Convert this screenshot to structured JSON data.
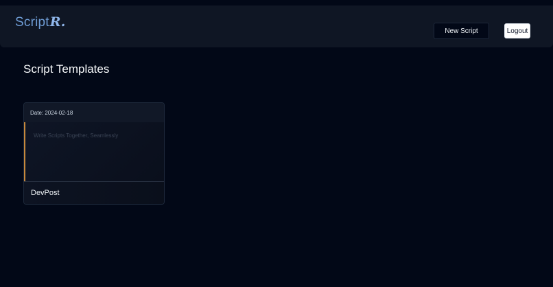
{
  "header": {
    "brand_text": "Script",
    "brand_accent": "R.",
    "new_script_label": "New Script",
    "logout_label": "Logout"
  },
  "main": {
    "page_title": "Script Templates",
    "cards": [
      {
        "date": "Date: 2024-02-18",
        "preview": "Write Scripts Together, Seamlessly",
        "title": "DevPost"
      }
    ]
  },
  "colors": {
    "background": "#020817",
    "navbar": "#0f1624",
    "brand": "#6f9dd6",
    "card_accent": "#c7893c"
  }
}
